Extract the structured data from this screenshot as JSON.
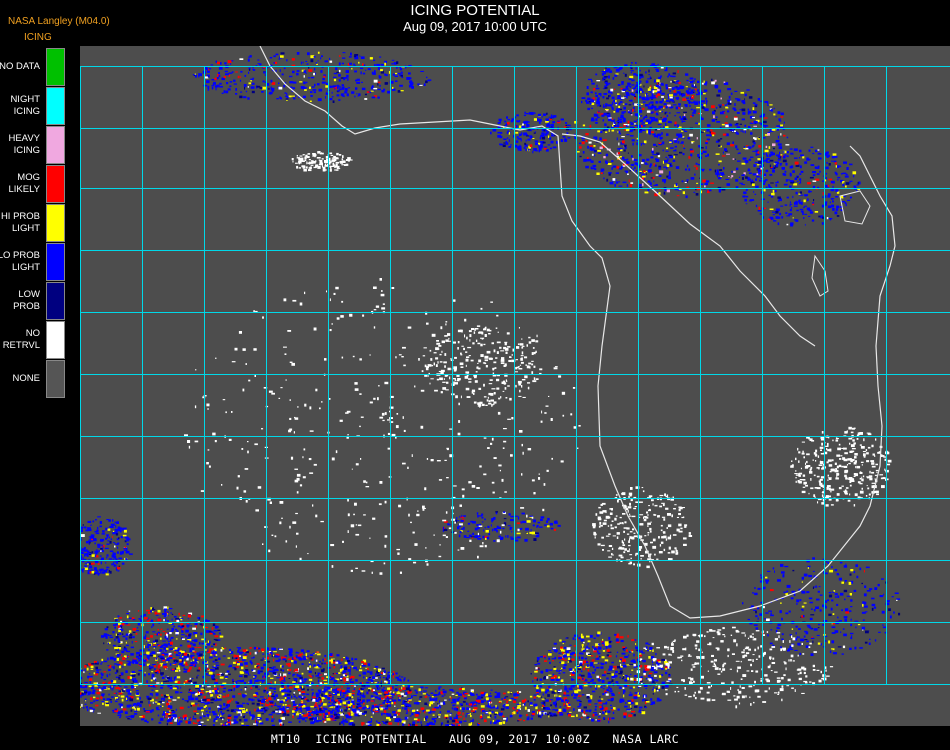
{
  "header": {
    "provider": "NASA Langley (M04.0)",
    "title": "ICING POTENTIAL",
    "subtitle": "Aug 09, 2017 10:00 UTC"
  },
  "legend": {
    "title": "ICING",
    "items": [
      {
        "label": "NO DATA",
        "color": "#00c000"
      },
      {
        "label": "NIGHT\nICING",
        "color": "#00ffff"
      },
      {
        "label": "HEAVY\nICING",
        "color": "#f0a8e0"
      },
      {
        "label": "MOG\nLIKELY",
        "color": "#ff0000"
      },
      {
        "label": "HI PROB\nLIGHT",
        "color": "#ffff00"
      },
      {
        "label": "LO PROB\nLIGHT",
        "color": "#0000ff"
      },
      {
        "label": "LOW\nPROB",
        "color": "#000080"
      },
      {
        "label": "NO\nRETRVL",
        "color": "#ffffff"
      },
      {
        "label": "NONE",
        "color": "#555555"
      }
    ]
  },
  "map": {
    "background": "#4d4d4d",
    "grid_color": "#00d8e8",
    "coast_color": "#e8e8e8",
    "grid_label_color": "#c00000"
  },
  "footer": "MT10  ICING POTENTIAL   AUG 09, 2017 10:00Z   NASA LARC"
}
